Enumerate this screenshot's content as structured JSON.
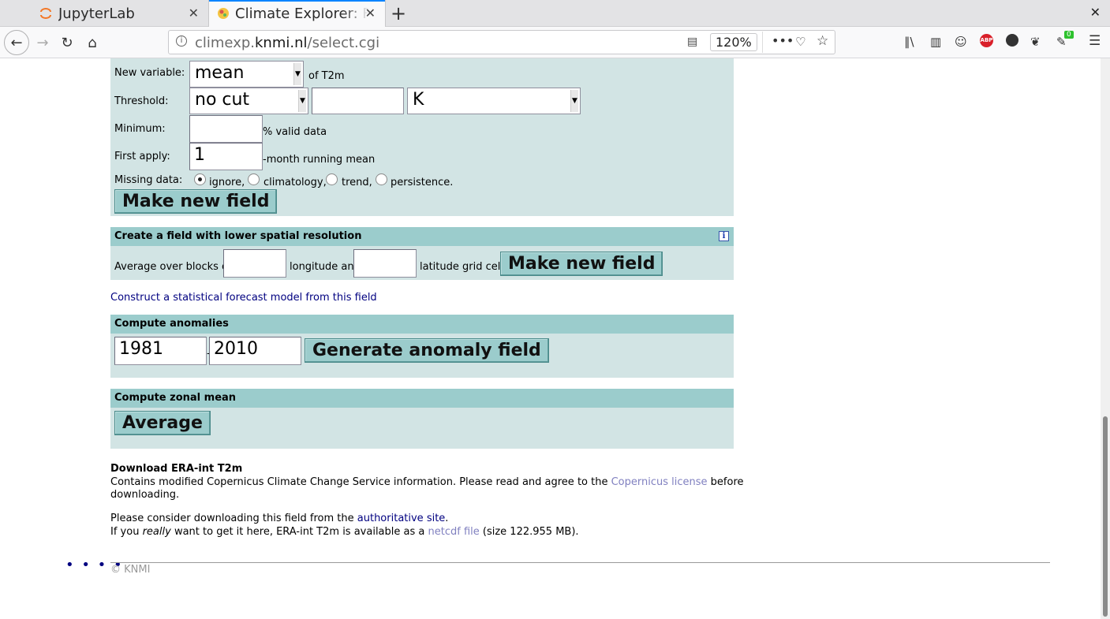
{
  "browser": {
    "tabs": [
      {
        "label": "JupyterLab",
        "icon": "jupyter-icon",
        "active": false
      },
      {
        "label": "Climate Explorer: F",
        "icon": "climate-explorer-icon",
        "active": true
      }
    ],
    "url_prefix": "climexp.",
    "url_host": "knmi.nl",
    "url_path": "/select.cgi",
    "zoom": "120%",
    "addon_badge": "0"
  },
  "new_variable": {
    "label": "New variable:",
    "value": "mean",
    "suffix": "of T2m"
  },
  "threshold": {
    "label": "Threshold:",
    "cut_value": "no cut",
    "value": "",
    "unit": "K"
  },
  "minimum": {
    "label": "Minimum:",
    "value": "",
    "suffix": "% valid data"
  },
  "first_apply": {
    "label": "First apply:",
    "value": "1",
    "suffix": "-month running mean"
  },
  "missing_data": {
    "label": "Missing data:",
    "options": [
      "ignore,",
      "climatology,",
      "trend,",
      "persistence."
    ],
    "selected": "ignore,"
  },
  "make_new_field_1": "Make new field",
  "lower_resolution": {
    "title": "Create a field with lower spatial resolution",
    "info_icon": "i",
    "label_before": "Average over blocks of",
    "lon_value": "",
    "label_mid": "longitude and",
    "lat_value": "",
    "label_after": "latitude grid cells",
    "button": "Make new field"
  },
  "forecast_link": "Construct a statistical forecast model from this field",
  "anomalies": {
    "title": "Compute anomalies",
    "start": "1981",
    "sep": "-",
    "end": "2010",
    "button": "Generate anomaly field"
  },
  "zonal": {
    "title": "Compute zonal mean",
    "button": "Average"
  },
  "download": {
    "title": "Download ERA-int T2m",
    "text1": "Contains modified Copernicus Climate Change Service information. Please read and agree to the",
    "license_link": "Copernicus license",
    "text1_end": "before",
    "text1_line2": "downloading.",
    "text2": "Please consider downloading this field from the",
    "auth_link": "authoritative site",
    "text2_end": ".",
    "text3_a": "If you",
    "text3_em": "really",
    "text3_b": "want to get it here, ERA-int T2m is available as a",
    "netcdf_link": "netcdf file",
    "text3_c": "(size 122.955 MB)."
  },
  "footer": {
    "dots": "• • • •",
    "copyright": "© KNMI"
  }
}
